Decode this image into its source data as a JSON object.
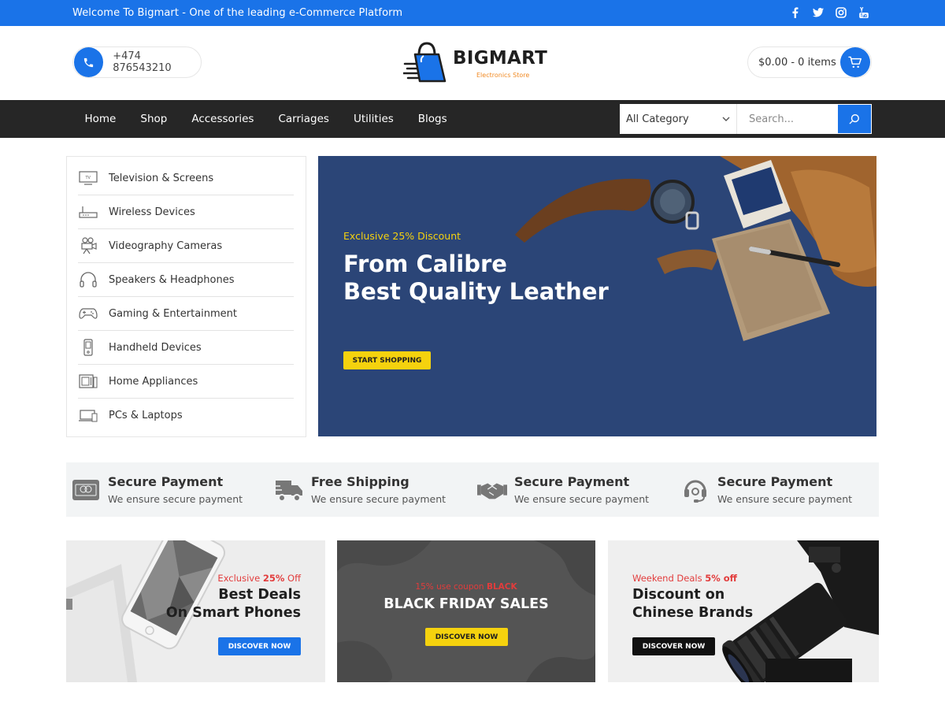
{
  "topbar": {
    "welcome": "Welcome To Bigmart - One of the leading e-Commerce Platform",
    "social_icons": [
      "facebook-icon",
      "twitter-icon",
      "instagram-icon",
      "youtube-icon"
    ]
  },
  "header": {
    "phone": "+474 876543210",
    "brand": "BIGMART",
    "tagline": "Electronics Store",
    "cart": "$0.00 - 0 items"
  },
  "nav": {
    "items": [
      "Home",
      "Shop",
      "Accessories",
      "Carriages",
      "Utilities",
      "Blogs"
    ],
    "category_selected": "All Category",
    "search_placeholder": "Search..."
  },
  "sidebar": {
    "items": [
      {
        "label": "Television & Screens",
        "icon": "tv-icon"
      },
      {
        "label": "Wireless Devices",
        "icon": "router-icon"
      },
      {
        "label": "Videography Cameras",
        "icon": "video-camera-icon"
      },
      {
        "label": "Speakers & Headphones",
        "icon": "headphones-icon"
      },
      {
        "label": "Gaming & Entertainment",
        "icon": "gamepad-icon"
      },
      {
        "label": "Handheld Devices",
        "icon": "handheld-icon"
      },
      {
        "label": "Home Appliances",
        "icon": "appliance-icon"
      },
      {
        "label": "PCs & Laptops",
        "icon": "laptop-icon"
      }
    ]
  },
  "hero": {
    "eyebrow": "Exclusive 25% Discount",
    "title_line1": "From Calibre",
    "title_line2": "Best Quality Leather",
    "cta": "START SHOPPING"
  },
  "features": [
    {
      "title": "Secure Payment",
      "subtitle": "We ensure secure payment",
      "icon": "credit-card-icon"
    },
    {
      "title": "Free Shipping",
      "subtitle": "We ensure secure payment",
      "icon": "truck-icon"
    },
    {
      "title": "Secure Payment",
      "subtitle": "We ensure secure payment",
      "icon": "handshake-icon"
    },
    {
      "title": "Secure Payment",
      "subtitle": "We ensure secure payment",
      "icon": "support-headset-icon"
    }
  ],
  "promos": [
    {
      "eyebrow_pre": "Exclusive ",
      "eyebrow_hl": "25%",
      "eyebrow_post": " Off",
      "title_line1": "Best Deals",
      "title_line2": "On Smart Phones",
      "cta": "DISCOVER NOW"
    },
    {
      "eyebrow_pre": "15% use coupon ",
      "eyebrow_hl": "BLACK",
      "eyebrow_post": "",
      "title_line1": "BLACK FRIDAY SALES",
      "title_line2": "",
      "cta": "DISCOVER NOW"
    },
    {
      "eyebrow_pre": "Weekend Deals ",
      "eyebrow_hl": "5% off",
      "eyebrow_post": "",
      "title_line1": "Discount on",
      "title_line2": "Chinese Brands",
      "cta": "DISCOVER NOW"
    }
  ],
  "colors": {
    "primary": "#1a73e8",
    "nav_bg": "#262626",
    "hero_bg": "#2b4577",
    "accent_yellow": "#f5d20e",
    "promo_red": "#e23c3c"
  }
}
